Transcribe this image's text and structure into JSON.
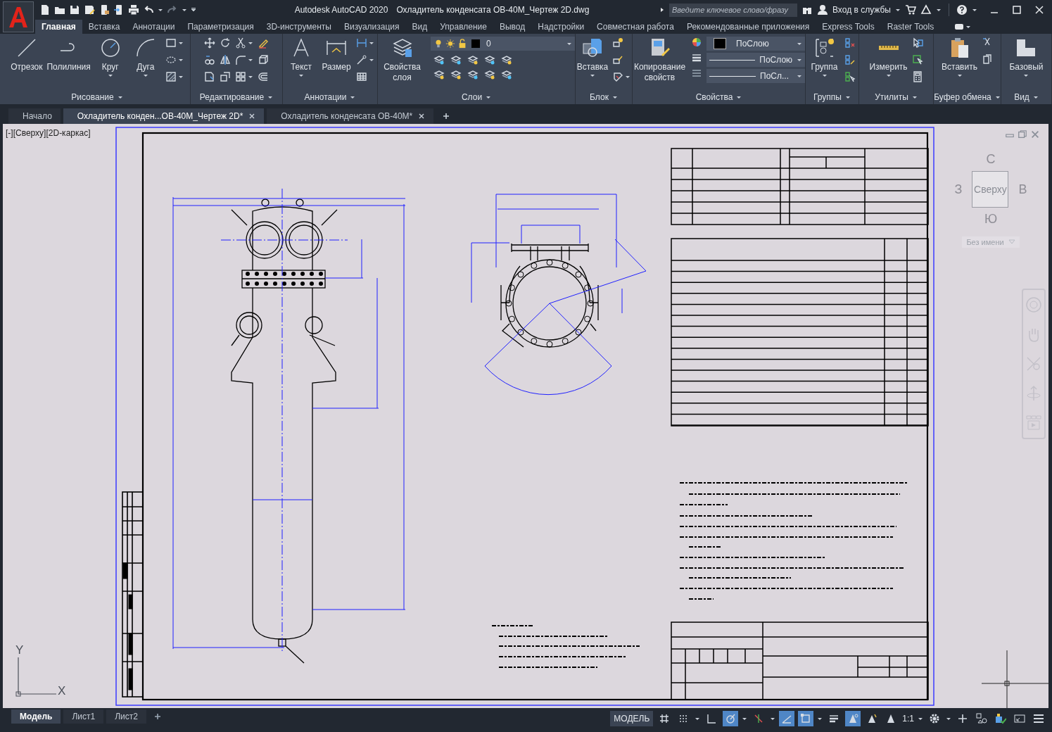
{
  "title_bar": {
    "app_name": "Autodesk AutoCAD 2020",
    "file_name": "Охладитель конденсата ОВ-40М_Чертеж 2D.dwg",
    "search": {
      "placeholder": "Введите ключевое слово/фразу"
    },
    "sign_in": "Вход в службы"
  },
  "ribbon_tabs": [
    {
      "label": "Главная",
      "selected": true
    },
    {
      "label": "Вставка",
      "selected": false
    },
    {
      "label": "Аннотации",
      "selected": false
    },
    {
      "label": "Параметризация",
      "selected": false
    },
    {
      "label": "3D-инструменты",
      "selected": false
    },
    {
      "label": "Визуализация",
      "selected": false
    },
    {
      "label": "Вид",
      "selected": false
    },
    {
      "label": "Управление",
      "selected": false
    },
    {
      "label": "Вывод",
      "selected": false
    },
    {
      "label": "Надстройки",
      "selected": false
    },
    {
      "label": "Совместная работа",
      "selected": false
    },
    {
      "label": "Рекомендованные приложения",
      "selected": false
    },
    {
      "label": "Express Tools",
      "selected": false
    },
    {
      "label": "Raster Tools",
      "selected": false
    }
  ],
  "ribbon_panels": [
    {
      "kind": "draw",
      "title": "Рисование",
      "buttons": [
        {
          "label": "Отрезок",
          "dropdown": false
        },
        {
          "label": "Полилиния",
          "dropdown": false
        },
        {
          "label": "Круг",
          "dropdown": true
        },
        {
          "label": "Дуга",
          "dropdown": true
        }
      ]
    },
    {
      "kind": "modify",
      "title": "Редактирование"
    },
    {
      "kind": "annotation",
      "title": "Аннотации",
      "buttons": [
        {
          "label": "Текст",
          "dropdown": true
        },
        {
          "label": "Размер",
          "dropdown": false
        }
      ]
    },
    {
      "kind": "layers",
      "title": "Слои",
      "buttons": [
        {
          "label": "Свойства слоя",
          "dropdown": false
        }
      ],
      "fields": [
        "0"
      ]
    },
    {
      "kind": "block",
      "title": "Блок",
      "buttons": [
        {
          "label": "Вставка",
          "dropdown": true
        }
      ]
    },
    {
      "kind": "properties",
      "title": "Свойства",
      "buttons": [
        {
          "label": "Копирование свойств",
          "dropdown": false
        }
      ],
      "fields": [
        "ПоСлою",
        "ПоСлою",
        "ПоСл..."
      ]
    },
    {
      "kind": "groups",
      "title": "Группы",
      "buttons": [
        {
          "label": "Группа",
          "dropdown": true
        }
      ]
    },
    {
      "kind": "utilities",
      "title": "Утилиты",
      "buttons": [
        {
          "label": "Измерить",
          "dropdown": true
        }
      ]
    },
    {
      "kind": "clipboard",
      "title": "Буфер обмена",
      "buttons": [
        {
          "label": "Вставить",
          "dropdown": true
        }
      ]
    },
    {
      "kind": "view",
      "title": "Вид",
      "buttons": [
        {
          "label": "Базовый",
          "dropdown": true
        }
      ]
    }
  ],
  "doc_tabs": [
    {
      "label": "Начало",
      "selected": false,
      "closable": false
    },
    {
      "label": "Охладитель конден...ОВ-40М_Чертеж 2D*",
      "selected": true,
      "closable": true
    },
    {
      "label": "Охладитель конденсата ОВ-40М*",
      "selected": false,
      "closable": true
    }
  ],
  "viewport": {
    "label": "[-][Сверху][2D-каркас]",
    "viewcube": {
      "north": "С",
      "west": "З",
      "face": "Сверху",
      "east": "В",
      "south": "Ю",
      "ucs": "Без имени"
    },
    "axes": {
      "y": "Y",
      "x": "X"
    }
  },
  "layout_tabs": [
    {
      "label": "Модель",
      "selected": true
    },
    {
      "label": "Лист1",
      "selected": false
    },
    {
      "label": "Лист2",
      "selected": false
    }
  ],
  "status_bar": {
    "space": "МОДЕЛЬ",
    "scale": "1:1",
    "toggles": [
      {
        "kind": "grid",
        "on": false
      },
      {
        "kind": "snap",
        "on": false
      },
      {
        "kind": "ortho",
        "on": false
      },
      {
        "kind": "polar",
        "on": true
      },
      {
        "kind": "isodraft",
        "on": false
      },
      {
        "kind": "otrack",
        "on": true
      },
      {
        "kind": "osnap",
        "on": true
      },
      {
        "kind": "lineweight",
        "on": false
      },
      {
        "kind": "annovisibility",
        "on": true
      },
      {
        "kind": "autoscale",
        "on": false
      },
      {
        "kind": "annoscale",
        "on": false
      }
    ]
  }
}
